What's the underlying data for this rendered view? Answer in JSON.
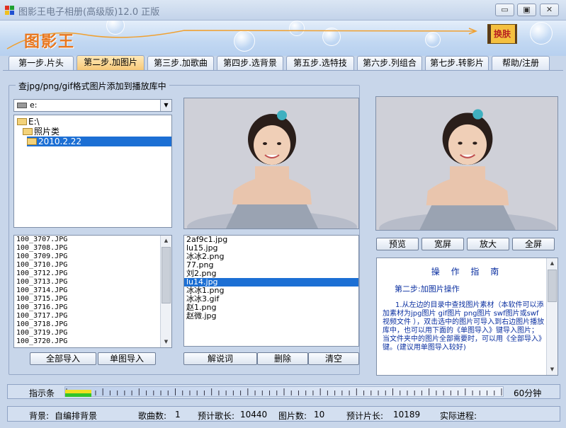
{
  "window": {
    "title": "图影王电子相册(高级版)12.0 正版",
    "minimize": "▭",
    "maximize": "▣",
    "close": "✕"
  },
  "banner": {
    "logo": "图影王",
    "swap_label": "换肤"
  },
  "tabs": [
    {
      "label": "第一步.片头"
    },
    {
      "label": "第二步.加图片",
      "active": true
    },
    {
      "label": "第三步.加歌曲"
    },
    {
      "label": "第四步.选背景"
    },
    {
      "label": "第五步.选特技"
    },
    {
      "label": "第六步.列组合"
    },
    {
      "label": "第七步.转影片"
    },
    {
      "label": "帮助/注册"
    }
  ],
  "group_title": "查jpg/png/gif格式图片添加到播放库中",
  "drive": {
    "value": "e:"
  },
  "tree": [
    "E:\\",
    "照片类",
    "2010.2.22"
  ],
  "files": [
    "100_3707.JPG",
    "100_3708.JPG",
    "100_3709.JPG",
    "100_3710.JPG",
    "100_3712.JPG",
    "100_3713.JPG",
    "100_3714.JPG",
    "100_3715.JPG",
    "100_3716.JPG",
    "100_3717.JPG",
    "100_3718.JPG",
    "100_3719.JPG",
    "100_3720.JPG"
  ],
  "buttons": {
    "import_all": "全部导入",
    "import_single": "单图导入",
    "caption": "解说词",
    "delete": "删除",
    "clear": "清空",
    "preview": "预览",
    "widescreen": "宽屏",
    "zoom": "放大",
    "fullscreen": "全屏"
  },
  "playlist": [
    "2af9c1.jpg",
    "lu15.jpg",
    "冰冰2.png",
    "77.png",
    "刘2.png",
    "lu14.jpg",
    "冰冰1.png",
    "冰冰3.gif",
    "赵1.png",
    "赵微.jpg"
  ],
  "playlist_selected": 5,
  "guide": {
    "title": "操 作 指 南",
    "step": "第二步:加图片操作",
    "body": "1.从左边的目录中查找图片素材（本软件可以添加素材为jpg图片 gif图片 png图片 swf图片或swf视频文件 ），双击选中的图片可导入到右边图片播放库中，也可以用下面的《单图导入》键导入图片；当文件夹中的图片全部需要时，可以用《全部导入》键。(建议用单图导入较好)"
  },
  "indicator": {
    "label": "指示条",
    "end_label": "60分钟",
    "progress_fraction": 0.06
  },
  "status": {
    "bg_label": "背景:",
    "bg_value": "自编排背景",
    "songs_label": "歌曲数:",
    "songs_value": "1",
    "song_len_label": "预计歌长:",
    "song_len_value": "10440",
    "pics_label": "图片数:",
    "pics_value": "10",
    "film_len_label": "预计片长:",
    "film_len_value": "10189",
    "progress_label": "实际进程:"
  }
}
